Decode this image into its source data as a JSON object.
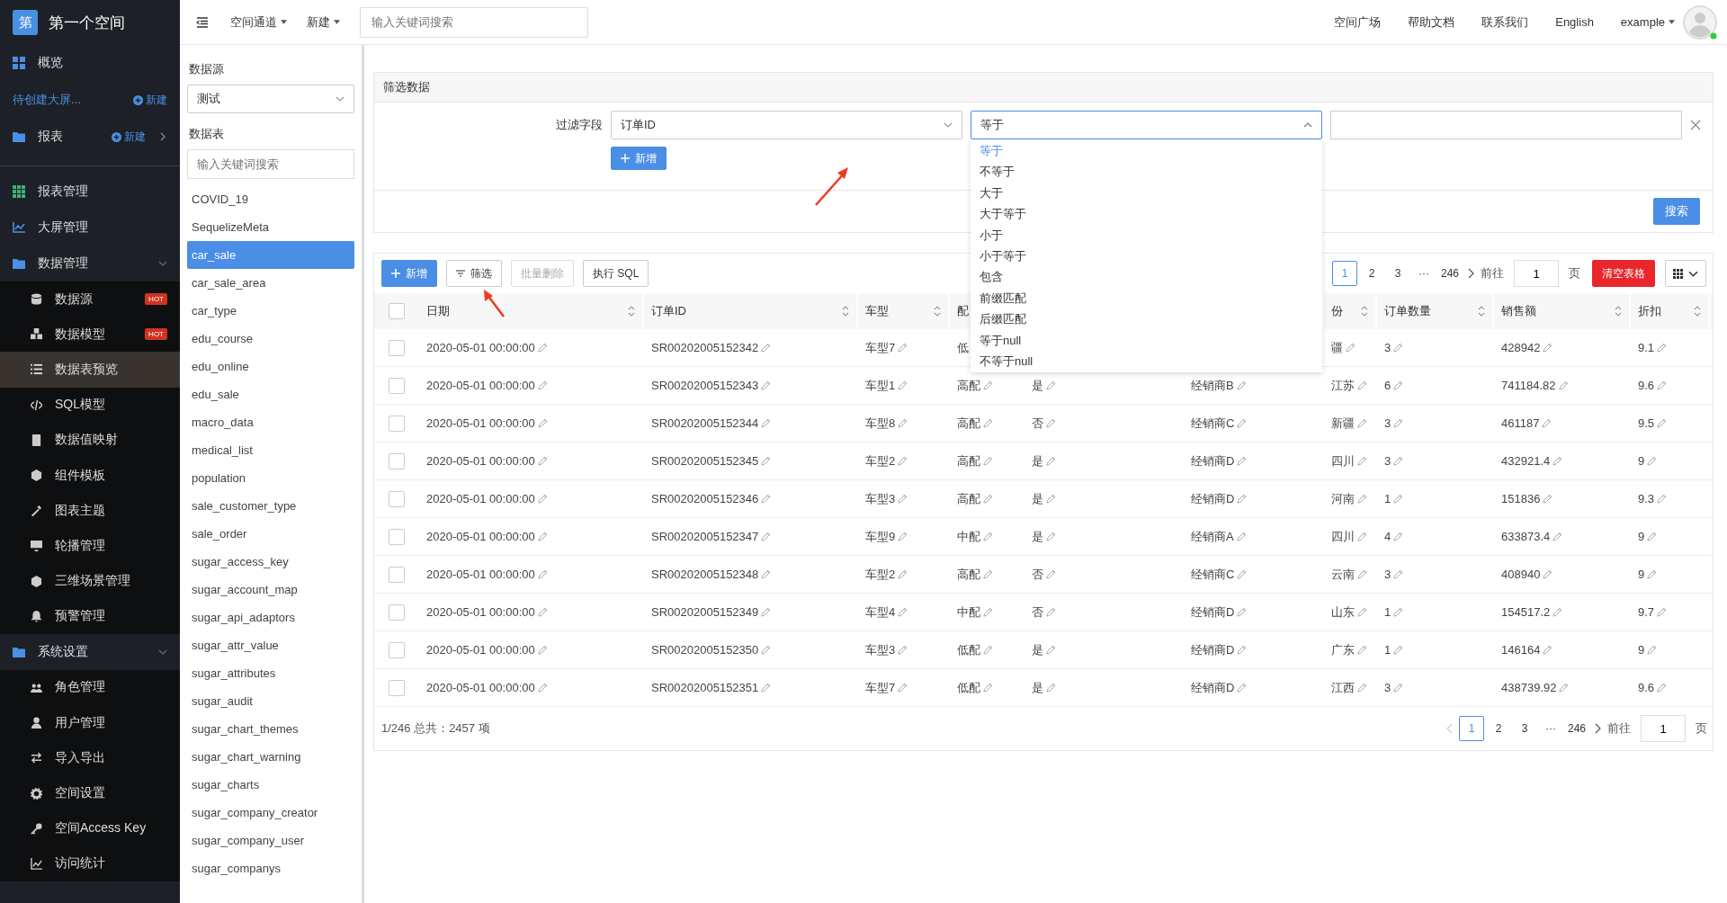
{
  "brand": {
    "logo": "第",
    "name": "第一个空间"
  },
  "top_nav": [
    {
      "kind": "item",
      "label": "概览"
    },
    {
      "kind": "pending",
      "label": "待创建大屏...",
      "action": "新建"
    },
    {
      "kind": "folder",
      "label": "报表",
      "action": "新建"
    }
  ],
  "menu": [
    {
      "label": "报表管理"
    },
    {
      "label": "大屏管理"
    },
    {
      "label": "数据管理",
      "expanded": true,
      "children": [
        {
          "label": "数据源",
          "badge": "HOT",
          "selected": false
        },
        {
          "label": "数据模型",
          "badge": "HOT",
          "selected": false
        },
        {
          "label": "数据表预览",
          "selected": true
        },
        {
          "label": "SQL模型",
          "selected": false
        },
        {
          "label": "数据值映射",
          "selected": false
        },
        {
          "label": "组件模板",
          "selected": false
        },
        {
          "label": "图表主题",
          "selected": false
        },
        {
          "label": "轮播管理",
          "selected": false
        },
        {
          "label": "三维场景管理",
          "selected": false
        },
        {
          "label": "预警管理",
          "selected": false
        }
      ]
    },
    {
      "label": "系统设置",
      "expanded": true,
      "children": [
        {
          "label": "角色管理",
          "selected": false
        },
        {
          "label": "用户管理",
          "selected": false
        },
        {
          "label": "导入导出",
          "selected": false
        },
        {
          "label": "空间设置",
          "selected": false
        },
        {
          "label": "空间Access Key",
          "selected": false
        },
        {
          "label": "访问统计",
          "selected": false
        }
      ]
    }
  ],
  "header": {
    "menus": [
      "空间通道",
      "新建"
    ],
    "search": {
      "placeholder": "输入关键词搜索"
    },
    "links": [
      "空间广场",
      "帮助文档",
      "联系我们",
      "English"
    ],
    "user": "example"
  },
  "source_panel": {
    "source_label": "数据源",
    "source_value": "测试",
    "table_label": "数据表",
    "search": {
      "placeholder": "输入关键词搜索"
    },
    "tables": [
      {
        "name": "COVID_19",
        "selected": false
      },
      {
        "name": "SequelizeMeta",
        "selected": false
      },
      {
        "name": "car_sale",
        "selected": true
      },
      {
        "name": "car_sale_area",
        "selected": false
      },
      {
        "name": "car_type",
        "selected": false
      },
      {
        "name": "edu_course",
        "selected": false
      },
      {
        "name": "edu_online",
        "selected": false
      },
      {
        "name": "edu_sale",
        "selected": false
      },
      {
        "name": "macro_data",
        "selected": false
      },
      {
        "name": "medical_list",
        "selected": false
      },
      {
        "name": "population",
        "selected": false
      },
      {
        "name": "sale_customer_type",
        "selected": false
      },
      {
        "name": "sale_order",
        "selected": false
      },
      {
        "name": "sugar_access_key",
        "selected": false
      },
      {
        "name": "sugar_account_map",
        "selected": false
      },
      {
        "name": "sugar_api_adaptors",
        "selected": false
      },
      {
        "name": "sugar_attr_value",
        "selected": false
      },
      {
        "name": "sugar_attributes",
        "selected": false
      },
      {
        "name": "sugar_audit",
        "selected": false
      },
      {
        "name": "sugar_chart_themes",
        "selected": false
      },
      {
        "name": "sugar_chart_warning",
        "selected": false
      },
      {
        "name": "sugar_charts",
        "selected": false
      },
      {
        "name": "sugar_company_creator",
        "selected": false
      },
      {
        "name": "sugar_company_user",
        "selected": false
      },
      {
        "name": "sugar_companys",
        "selected": false
      }
    ]
  },
  "filter": {
    "title": "筛选数据",
    "label": "过滤字段",
    "field": "订单ID",
    "operator": "等于",
    "operator_open": true,
    "options": [
      {
        "label": "等于",
        "selected": true
      },
      {
        "label": "不等于",
        "selected": false
      },
      {
        "label": "大于",
        "selected": false
      },
      {
        "label": "大于等于",
        "selected": false
      },
      {
        "label": "小于",
        "selected": false
      },
      {
        "label": "小于等于",
        "selected": false
      },
      {
        "label": "包含",
        "selected": false
      },
      {
        "label": "前缀匹配",
        "selected": false
      },
      {
        "label": "后缀匹配",
        "selected": false
      },
      {
        "label": "等于null",
        "selected": false
      },
      {
        "label": "不等于null",
        "selected": false
      }
    ],
    "add_button": "新增",
    "search_button": "搜索"
  },
  "toolbar": [
    {
      "label": "新增",
      "kind": "primary",
      "disabled": false
    },
    {
      "label": "筛选",
      "kind": "filter",
      "disabled": false
    },
    {
      "label": "批量删除",
      "kind": "default",
      "disabled": true
    },
    {
      "label": "执行 SQL",
      "kind": "default",
      "disabled": false
    }
  ],
  "top_pager": {
    "pages": [
      {
        "label": "1",
        "selected": true
      },
      {
        "label": "2",
        "selected": false
      },
      {
        "label": "3",
        "selected": false
      },
      {
        "label": "···",
        "selected": false
      },
      {
        "label": "246",
        "selected": false
      }
    ],
    "goto": "前往",
    "page": "1",
    "unit": "页",
    "clear_button": "清空表格"
  },
  "table": {
    "select_all": {
      "checked": false
    },
    "columns": [
      {
        "label": "日期"
      },
      {
        "label": "订单ID"
      },
      {
        "label": "车型"
      },
      {
        "label": "配",
        "cut": true
      },
      {},
      {},
      {
        "label": "份"
      },
      {
        "label": "订单数量"
      },
      {
        "label": "销售额"
      },
      {
        "label": "折扣"
      }
    ],
    "rows": [
      {
        "checked": false,
        "cells": [
          "2020-05-01 00:00:00",
          "SR00202005152342",
          "车型7",
          {
            "text": "低",
            "cut": true
          },
          null,
          null,
          "疆",
          "3",
          "428942",
          "9.1"
        ]
      },
      {
        "checked": false,
        "cells": [
          "2020-05-01 00:00:00",
          "SR00202005152343",
          "车型1",
          "高配",
          "是",
          "经销商B",
          "江苏",
          "6",
          "741184.82",
          "9.6"
        ]
      },
      {
        "checked": false,
        "cells": [
          "2020-05-01 00:00:00",
          "SR00202005152344",
          "车型8",
          "高配",
          "否",
          "经销商C",
          "新疆",
          "3",
          "461187",
          "9.5"
        ]
      },
      {
        "checked": false,
        "cells": [
          "2020-05-01 00:00:00",
          "SR00202005152345",
          "车型2",
          "高配",
          "是",
          "经销商D",
          "四川",
          "3",
          "432921.4",
          "9"
        ]
      },
      {
        "checked": false,
        "cells": [
          "2020-05-01 00:00:00",
          "SR00202005152346",
          "车型3",
          "高配",
          "是",
          "经销商D",
          "河南",
          "1",
          "151836",
          "9.3"
        ]
      },
      {
        "checked": false,
        "cells": [
          "2020-05-01 00:00:00",
          "SR00202005152347",
          "车型9",
          "中配",
          "是",
          "经销商A",
          "四川",
          "4",
          "633873.4",
          "9"
        ]
      },
      {
        "checked": false,
        "cells": [
          "2020-05-01 00:00:00",
          "SR00202005152348",
          "车型2",
          "高配",
          "否",
          "经销商C",
          "云南",
          "3",
          "408940",
          "9"
        ]
      },
      {
        "checked": false,
        "cells": [
          "2020-05-01 00:00:00",
          "SR00202005152349",
          "车型4",
          "中配",
          "否",
          "经销商D",
          "山东",
          "1",
          "154517.2",
          "9.7"
        ]
      },
      {
        "checked": false,
        "cells": [
          "2020-05-01 00:00:00",
          "SR00202005152350",
          "车型3",
          "低配",
          "是",
          "经销商D",
          "广东",
          "1",
          "146164",
          "9"
        ]
      },
      {
        "checked": false,
        "cells": [
          "2020-05-01 00:00:00",
          "SR00202005152351",
          "车型7",
          "低配",
          "是",
          "经销商D",
          "江西",
          "3",
          "438739.92",
          "9.6"
        ]
      }
    ]
  },
  "footer": {
    "summary": "1/246 总共：2457 项",
    "pages": [
      {
        "label": "1",
        "selected": true
      },
      {
        "label": "2",
        "selected": false
      },
      {
        "label": "3",
        "selected": false
      },
      {
        "label": "···",
        "selected": false
      },
      {
        "label": "246",
        "selected": false
      }
    ],
    "goto": "前往",
    "page": "1",
    "unit": "页"
  }
}
